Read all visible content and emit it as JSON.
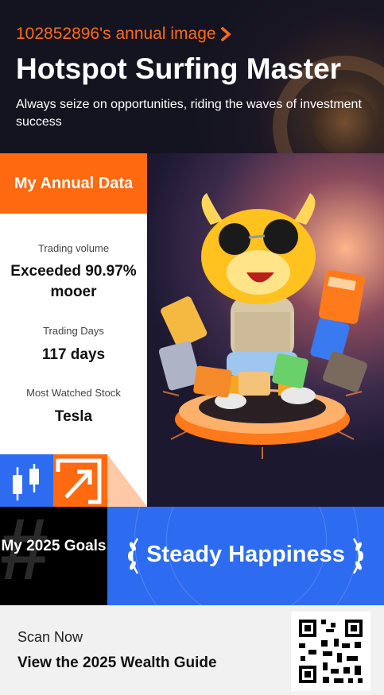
{
  "header": {
    "link_text": "102852896's annual image",
    "title": "Hotspot Surfing Master",
    "subtitle": "Always seize on opportunities, riding the waves of investment success"
  },
  "annual_data": {
    "heading": "My Annual Data",
    "stats": [
      {
        "label": "Trading volume",
        "value": "Exceeded 90.97% mooer"
      },
      {
        "label": "Trading Days",
        "value": "117 days"
      },
      {
        "label": "Most Watched Stock",
        "value": "Tesla"
      }
    ]
  },
  "goals": {
    "label": "My 2025 Goals",
    "goal_text": "Steady Happiness"
  },
  "footer": {
    "scan_label": "Scan Now",
    "guide_label": "View the 2025 Wealth Guide"
  },
  "icons": {
    "link_arrow": "chevron-right-icon",
    "candlestick": "candlestick-icon",
    "arrow": "arrow-up-right-icon",
    "laurel": "laurel-icon",
    "qr": "qr-code-icon"
  },
  "colors": {
    "accent_orange": "#ff6a10",
    "accent_blue": "#2d6bf0"
  }
}
